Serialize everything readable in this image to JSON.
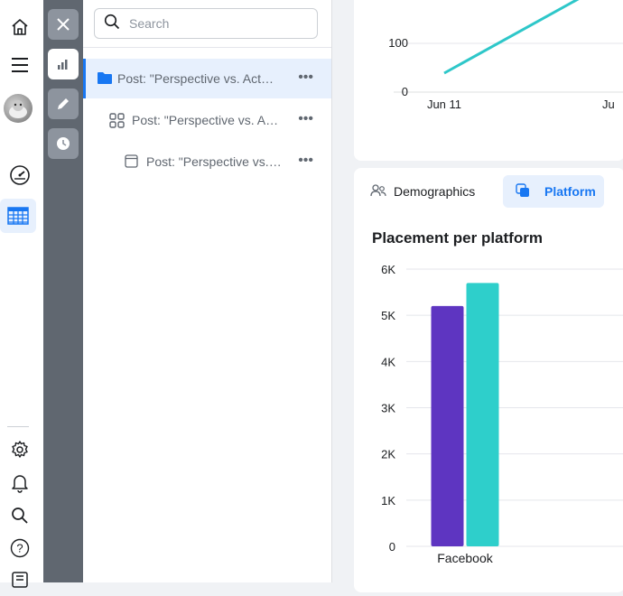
{
  "rail": {
    "items": [
      {
        "name": "home-icon"
      },
      {
        "name": "menu-icon"
      },
      {
        "name": "avatar"
      },
      {
        "name": "dashboard-gauge-icon"
      },
      {
        "name": "table-icon"
      },
      {
        "name": "settings-gear-icon"
      },
      {
        "name": "bell-icon"
      },
      {
        "name": "search-icon"
      },
      {
        "name": "help-icon"
      },
      {
        "name": "reports-icon"
      }
    ],
    "active_item": "table-icon"
  },
  "toolstrip": {
    "items": [
      "close-icon",
      "bar-chart-icon",
      "pencil-icon",
      "clock-icon"
    ],
    "active_item": "bar-chart-icon"
  },
  "tree": {
    "search_placeholder": "Search",
    "rows": [
      {
        "label": "Post: \"Perspective vs. Actu…",
        "icon": "folder-icon",
        "selected": true
      },
      {
        "label": "Post: \"Perspective vs. Ac…",
        "icon": "grid-icon",
        "selected": false
      },
      {
        "label": "Post: \"Perspective vs. …",
        "icon": "ad-icon",
        "selected": false
      }
    ],
    "more_label": "•••"
  },
  "top_chart": {
    "chart_data": {
      "type": "line",
      "x_ticks": [
        "Jun 11",
        "Ju"
      ],
      "y_ticks": [
        "100",
        "0"
      ],
      "series": [
        {
          "color": "#2ec7c9"
        }
      ]
    }
  },
  "tabs": [
    {
      "label": "Demographics",
      "icon": "people-icon",
      "active": false
    },
    {
      "label": "Platform",
      "icon": "platform-icon",
      "active": true
    }
  ],
  "placement_chart": {
    "title": "Placement per platform",
    "chart_data": {
      "type": "bar",
      "categories": [
        "Facebook"
      ],
      "series": [
        {
          "values": [
            5200
          ],
          "color": "#5e35c1"
        },
        {
          "values": [
            5700
          ],
          "color": "#2ecfcb"
        }
      ],
      "ylim": [
        0,
        6000
      ],
      "y_ticks": [
        "0",
        "1K",
        "2K",
        "3K",
        "4K",
        "5K",
        "6K"
      ],
      "y_tick_values": [
        0,
        1000,
        2000,
        3000,
        4000,
        5000,
        6000
      ]
    }
  }
}
